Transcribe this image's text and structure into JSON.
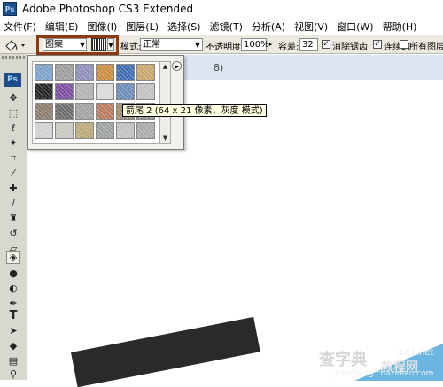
{
  "app": {
    "title": "Adobe Photoshop CS3 Extended",
    "badge": "Ps"
  },
  "menubar": {
    "items": [
      "文件(F)",
      "编辑(E)",
      "图像(I)",
      "图层(L)",
      "选择(S)",
      "滤镜(T)",
      "分析(A)",
      "视图(V)",
      "窗口(W)",
      "帮助(H)"
    ]
  },
  "options": {
    "fill_source_value": "图案",
    "mode_label": "模式:",
    "mode_value": "正常",
    "opacity_label": "不透明度:",
    "opacity_value": "100%",
    "tolerance_label": "容差:",
    "tolerance_value": "32",
    "anti_alias_label": "消除锯齿",
    "anti_alias_checked": true,
    "contiguous_label": "连续的",
    "contiguous_checked": true,
    "all_layers_label": "所有图层",
    "all_layers_checked": false
  },
  "toolbox": {
    "badge": "Ps",
    "tools": [
      "move-tool",
      "marquee-tool",
      "lasso-tool",
      "magic-wand-tool",
      "crop-tool",
      "eyedropper-tool",
      "healing-brush-tool",
      "brush-tool",
      "clone-stamp-tool",
      "history-brush-tool",
      "eraser-tool",
      "paint-bucket-tool",
      "blur-tool",
      "dodge-tool",
      "pen-tool",
      "type-tool",
      "path-selection-tool",
      "shape-tool",
      "notes-tool",
      "zoom-tool"
    ],
    "active_tool": "paint-bucket-tool"
  },
  "document": {
    "title_fragment": "8)"
  },
  "pattern_picker": {
    "tooltip": "箭尾 2 (64 x 21 像素，灰度 模式)",
    "swatch_colors": [
      [
        "#7aa0c8",
        "#9c9c9c",
        "#8c8cb8",
        "#c88a3c",
        "#3c6ab0",
        "#c8a46a"
      ],
      [
        "#202020",
        "#7a4c9c",
        "#b0b0b0",
        "#d8d8d8",
        "#6a8ab8",
        "#c0c0c0"
      ],
      [
        "#8a7a6a",
        "#6a6a6a",
        "#a0a0a0",
        "#b87a5a",
        "#9a8a6a",
        "#909090"
      ],
      [
        "#d0d0d0",
        "#c8c8c0",
        "#b8a878",
        "#9aa0a0",
        "#c0c0c0",
        "#a8a8a8"
      ]
    ]
  },
  "watermark": {
    "site": "jb51.net",
    "text_large": "查字典",
    "text_mid": "教程网",
    "text_url": "jiaocheng.chazidian.com"
  }
}
